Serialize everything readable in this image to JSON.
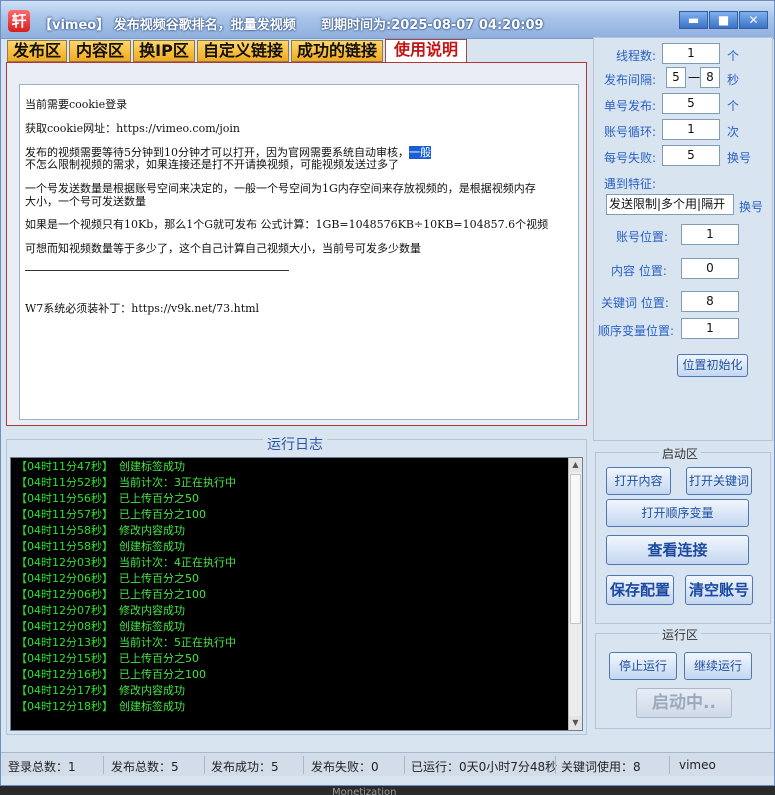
{
  "window": {
    "app_title": "【vimeo】 发布视频谷歌排名，批量发视频",
    "expire_label": "到期时间为:2025-08-07 04:20:09",
    "icon_glyph": "轩",
    "buttons": {
      "minimize": "▬",
      "maximize": "■",
      "close": "✕"
    }
  },
  "tabs": [
    "发布区",
    "内容区",
    "换IP区",
    "自定义链接",
    "成功的链接",
    "使用说明"
  ],
  "active_tab": "使用说明",
  "instructions": {
    "line1": "当前需要cookie登录",
    "line2": "获取cookie网址：https://vimeo.com/join",
    "line3a": "发布的视频需要等待5分钟到10分钟才可以打开，因为官网需要系统自动审核，",
    "line3b": "一般",
    "line4": "不怎么限制视频的需求，如果连接还是打不开请换视频，可能视频发送过多了",
    "line5": "一个号发送数量是根据账号空间来决定的，一般一个号空间为1G内存空间来存放视频的，是根据视频内存",
    "line6": "大小，一个号可发送数量",
    "line7": "如果是一个视频只有10Kb，那么1个G就可发布  公式计算：1GB=1048576KB÷10KB=104857.6个视频",
    "line8": "可想而知视频数量等于多少了，这个自己计算自己视频大小，当前号可发多少数量",
    "line9": "W7系统必须装补丁：https://v9k.net/73.html"
  },
  "log": {
    "title": "运行日志",
    "entries": [
      {
        "time": "【04时11分47秒】",
        "msg": "创建标签成功"
      },
      {
        "time": "【04时11分52秒】",
        "msg": "当前计次：3正在执行中"
      },
      {
        "time": "【04时11分56秒】",
        "msg": "已上传百分之50"
      },
      {
        "time": "【04时11分57秒】",
        "msg": "已上传百分之100"
      },
      {
        "time": "【04时11分58秒】",
        "msg": "修改内容成功"
      },
      {
        "time": "【04时11分58秒】",
        "msg": "创建标签成功"
      },
      {
        "time": "【04时12分03秒】",
        "msg": "当前计次：4正在执行中"
      },
      {
        "time": "【04时12分06秒】",
        "msg": "已上传百分之50"
      },
      {
        "time": "【04时12分06秒】",
        "msg": "已上传百分之100"
      },
      {
        "time": "【04时12分07秒】",
        "msg": "修改内容成功"
      },
      {
        "time": "【04时12分08秒】",
        "msg": "创建标签成功"
      },
      {
        "time": "【04时12分13秒】",
        "msg": "当前计次：5正在执行中"
      },
      {
        "time": "【04时12分15秒】",
        "msg": "已上传百分之50"
      },
      {
        "time": "【04时12分16秒】",
        "msg": "已上传百分之100"
      },
      {
        "time": "【04时12分17秒】",
        "msg": "修改内容成功"
      },
      {
        "time": "【04时12分18秒】",
        "msg": "创建标签成功"
      }
    ]
  },
  "settings": {
    "threads_label": "线程数:",
    "threads_value": "1",
    "threads_unit": "个",
    "interval_label": "发布间隔:",
    "interval_min": "5",
    "interval_dash": "一",
    "interval_max": "8",
    "interval_unit": "秒",
    "per_account_label": "单号发布:",
    "per_account_value": "5",
    "per_account_unit": "个",
    "loop_label": "账号循环:",
    "loop_value": "1",
    "loop_unit": "次",
    "fail_label": "每号失败:",
    "fail_value": "5",
    "fail_unit": "换号",
    "feature_label": "遇到特征:",
    "feature_value": "发送限制|多个用|隔开",
    "feature_unit": "换号",
    "account_pos_label": "账号位置:",
    "account_pos_value": "1",
    "content_pos_label": "内容 位置:",
    "content_pos_value": "0",
    "keyword_pos_label": "关键词 位置:",
    "keyword_pos_value": "8",
    "seq_pos_label": "顺序变量位置:",
    "seq_pos_value": "1",
    "reset_button": "位置初始化"
  },
  "start_area": {
    "title": "启动区",
    "open_content": "打开内容",
    "open_keywords": "打开关键词",
    "open_seq": "打开顺序变量",
    "view_links": "查看连接",
    "save_config": "保存配置",
    "clear_accounts": "清空账号"
  },
  "run_area": {
    "title": "运行区",
    "stop": "停止运行",
    "continue": "继续运行",
    "starting": "启动中.."
  },
  "status": {
    "login_total": "登录总数：1",
    "publish_total": "发布总数：5",
    "publish_ok": "发布成功：5",
    "publish_fail": "发布失败：0",
    "running": "已运行：0天0小时7分48秒",
    "keywords_used": "关键词使用：8",
    "platform": "vimeo"
  },
  "footer": "Monetization"
}
